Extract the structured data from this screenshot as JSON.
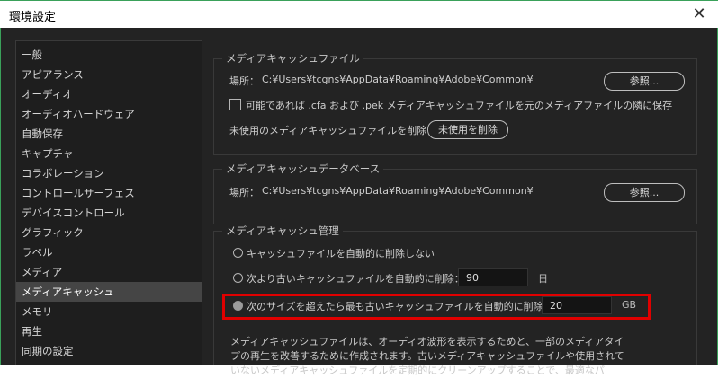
{
  "window": {
    "title": "環境設定",
    "close_glyph": "✕"
  },
  "sidebar": {
    "items": [
      {
        "label": "一般"
      },
      {
        "label": "アピアランス"
      },
      {
        "label": "オーディオ"
      },
      {
        "label": "オーディオハードウェア"
      },
      {
        "label": "自動保存"
      },
      {
        "label": "キャプチャ"
      },
      {
        "label": "コラボレーション"
      },
      {
        "label": "コントロールサーフェス"
      },
      {
        "label": "デバイスコントロール"
      },
      {
        "label": "グラフィック"
      },
      {
        "label": "ラベル"
      },
      {
        "label": "メディア"
      },
      {
        "label": "メディアキャッシュ",
        "selected": true
      },
      {
        "label": "メモリ"
      },
      {
        "label": "再生"
      },
      {
        "label": "同期の設定"
      }
    ]
  },
  "cache_files": {
    "title": "メディアキャッシュファイル",
    "location_label": "場所：",
    "location_path": "C:¥Users¥tcgns¥AppData¥Roaming¥Adobe¥Common¥",
    "browse_label": "参照...",
    "checkbox_label": "可能であれば .cfa および .pek メディアキャッシュファイルを元のメディアファイルの隣に保存",
    "unused_label": "未使用のメディアキャッシュファイルを削除",
    "unused_button": "未使用を削除"
  },
  "cache_db": {
    "title": "メディアキャッシュデータベース",
    "location_label": "場所：",
    "location_path": "C:¥Users¥tcgns¥AppData¥Roaming¥Adobe¥Common¥",
    "browse_label": "参照..."
  },
  "cache_mgmt": {
    "title": "メディアキャッシュ管理",
    "option_never": "キャッシュファイルを自動的に削除しない",
    "option_older": "次より古いキャッシュファイルを自動的に削除：",
    "older_value": "90",
    "older_unit": "日",
    "option_size": "次のサイズを超えたら最も古いキャッシュファイルを自動的に削除：",
    "size_value": "20",
    "size_unit": "GB",
    "selected_option": "size",
    "description_lines": [
      "メディアキャッシュファイルは、オーディオ波形を表示するためと、一部のメディアタイ",
      "プの再生を改善するために作成されます。古いメディアキャッシュファイルや使用されて",
      "いないメディアキャッシュファイルを定期的にクリーンアップすることで、最適なパ"
    ]
  },
  "colors": {
    "background": "#232323",
    "sidebar_background": "#1e1e1e",
    "selected_item": "#454545",
    "highlight_box": "#e00000",
    "window_border": "#3aa15a"
  }
}
